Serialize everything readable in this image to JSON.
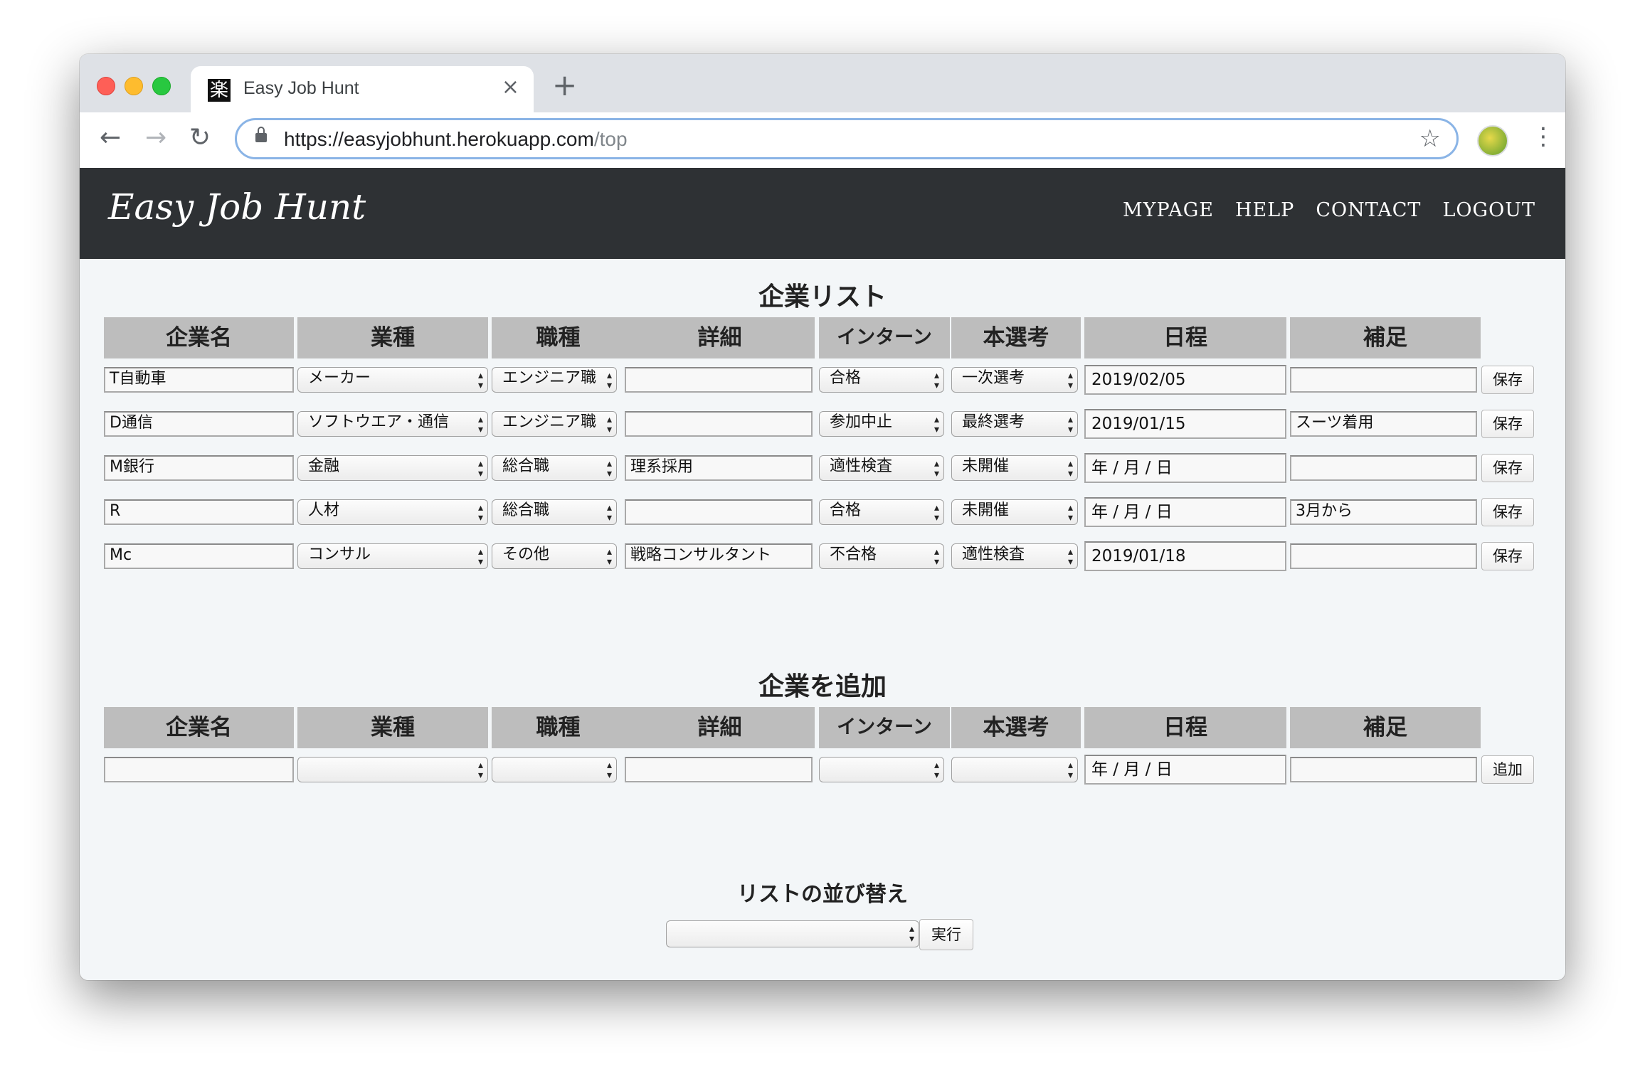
{
  "browser": {
    "tab_title": "Easy Job Hunt",
    "favicon_char": "楽",
    "tab_close": "×",
    "new_tab": "+",
    "url_host": "https://easyjobhunt.herokuapp.com",
    "url_path": "/top",
    "back": "←",
    "forward": "→",
    "reload": "↻",
    "star": "☆",
    "menu": "⋮"
  },
  "nav": {
    "brand": "Easy Job Hunt",
    "links": [
      "MYPAGE",
      "HELP",
      "CONTACT",
      "LOGOUT"
    ]
  },
  "columns": [
    "企業名",
    "業種",
    "職種",
    "詳細",
    "インターン",
    "本選考",
    "日程",
    "補足"
  ],
  "list": {
    "title": "企業リスト",
    "save_label": "保存",
    "rows": [
      {
        "name": "T自動車",
        "industry": "メーカー",
        "job": "エンジニア職",
        "detail": "",
        "intern": "合格",
        "selection": "一次選考",
        "date": "2019/02/05",
        "note": ""
      },
      {
        "name": "D通信",
        "industry": "ソフトウエア・通信",
        "job": "エンジニア職",
        "detail": "",
        "intern": "参加中止",
        "selection": "最終選考",
        "date": "2019/01/15",
        "note": "スーツ着用"
      },
      {
        "name": "M銀行",
        "industry": "金融",
        "job": "総合職",
        "detail": "理系採用",
        "intern": "適性検査",
        "selection": "未開催",
        "date": "年 / 月 / 日",
        "note": ""
      },
      {
        "name": "R",
        "industry": "人材",
        "job": "総合職",
        "detail": "",
        "intern": "合格",
        "selection": "未開催",
        "date": "年 / 月 / 日",
        "note": "3月から"
      },
      {
        "name": "Mc",
        "industry": "コンサル",
        "job": "その他",
        "detail": "戦略コンサルタント",
        "intern": "不合格",
        "selection": "適性検査",
        "date": "2019/01/18",
        "note": ""
      }
    ]
  },
  "add": {
    "title": "企業を追加",
    "date_placeholder": "年 / 月 / 日",
    "submit_label": "追加"
  },
  "sort": {
    "title": "リストの並び替え",
    "run_label": "実行"
  }
}
